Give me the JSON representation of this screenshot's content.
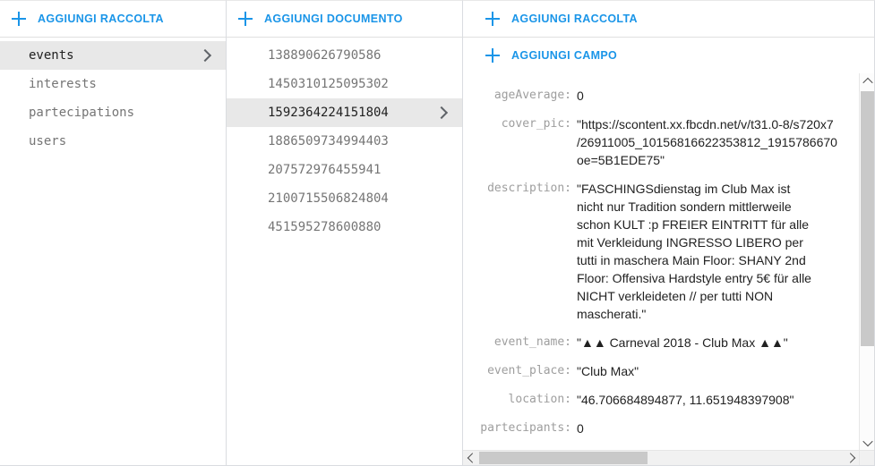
{
  "colors": {
    "accent": "#1a95e8",
    "selected_row_bg": "#e8e8e8",
    "label_gray": "#9e9e9e",
    "text_dark": "#212121",
    "border": "#dadce0",
    "scrollbar_thumb": "#c9c9c9"
  },
  "collections_panel": {
    "add_button_label": "AGGIUNGI RACCOLTA",
    "add_button_icon": "plus-icon",
    "items": [
      {
        "name": "events",
        "selected": true
      },
      {
        "name": "interests",
        "selected": false
      },
      {
        "name": "partecipations",
        "selected": false
      },
      {
        "name": "users",
        "selected": false
      }
    ]
  },
  "documents_panel": {
    "add_button_label": "AGGIUNGI DOCUMENTO",
    "add_button_icon": "plus-icon",
    "items": [
      {
        "name": "138890626790586",
        "selected": false
      },
      {
        "name": "1450310125095302",
        "selected": false
      },
      {
        "name": "1592364224151804",
        "selected": true
      },
      {
        "name": "1886509734994403",
        "selected": false
      },
      {
        "name": "207572976455941",
        "selected": false
      },
      {
        "name": "2100715506824804",
        "selected": false
      },
      {
        "name": "451595278600880",
        "selected": false
      }
    ]
  },
  "fields_panel": {
    "add_collection_label": "AGGIUNGI RACCOLTA",
    "add_field_label": "AGGIUNGI CAMPO",
    "add_collection_icon": "plus-icon",
    "add_field_icon": "plus-icon",
    "fields": [
      {
        "key": "ageAverage:",
        "value": "0"
      },
      {
        "key": "cover_pic:",
        "value": "\"https://scontent.xx.fbcdn.net/v/t31.0-8/s720x7\n/26911005_10156816622353812_1915786670\noe=5B1EDE75\""
      },
      {
        "key": "description:",
        "value": "\"FASCHINGSdienstag im Club Max ist nicht nur Tradition sondern mittlerweile schon KULT :p FREIER EINTRITT für alle mit Verkleidung INGRESSO LIBERO per tutti in maschera Main Floor: SHANY 2nd Floor: Offensiva Hardstyle entry 5€ für alle NICHT verkleideten // per tutti NON mascherati.\""
      },
      {
        "key": "event_name:",
        "value": "\"▲▲ Carneval 2018 - Club Max ▲▲\""
      },
      {
        "key": "event_place:",
        "value": "\"Club Max\""
      },
      {
        "key": "location:",
        "value": "\"46.706684894877, 11.651948397908\""
      },
      {
        "key": "partecipants:",
        "value": "0"
      }
    ]
  },
  "scrollbars": {
    "vertical_up_icon": "chevron-up-icon",
    "vertical_down_icon": "chevron-down-icon",
    "horizontal_left_icon": "chevron-left-icon",
    "horizontal_right_icon": "chevron-right-icon"
  }
}
